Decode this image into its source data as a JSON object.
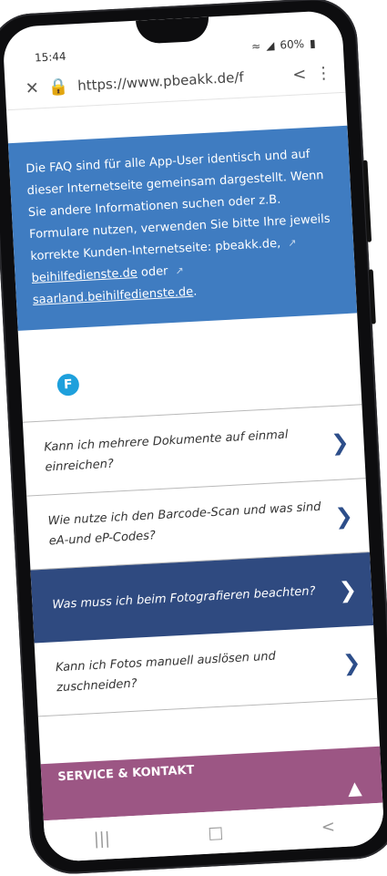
{
  "status_bar": {
    "time": "15:44",
    "battery": "60%"
  },
  "browser": {
    "url": "https://www.pbeakk.de/f"
  },
  "info_box": {
    "text": "Die FAQ sind für alle App-User identisch und auf dieser Internetseite gemeinsam dargestellt. Wenn Sie andere Informationen suchen oder z.B. Formulare nutzen, verwenden Sie bitte Ihre jeweils korrekte Kunden-Internetseite: ",
    "link1": "pbeakk.de,",
    "link2": "beihilfedienste.de",
    "connector": "oder",
    "link3": "saarland.beihilfedienste.de",
    "end": "."
  },
  "section_letter": "F",
  "faq_items": [
    {
      "question": "Kann ich mehrere Dokumente auf einmal einreichen?"
    },
    {
      "question": "Wie nutze ich den Barcode-Scan und was sind eA-und eP-Codes?"
    },
    {
      "question": "Was muss ich beim Fotografieren beachten?"
    },
    {
      "question": "Kann ich Fotos manuell auslösen und zuschneiden?"
    }
  ],
  "footer_section": {
    "label": "SERVICE & KONTAKT"
  },
  "colors": {
    "info_blue": "#3f7cc1",
    "active_navy": "#2f4a80",
    "service_purple": "#9c5684",
    "badge_blue": "#1ea0dc"
  }
}
